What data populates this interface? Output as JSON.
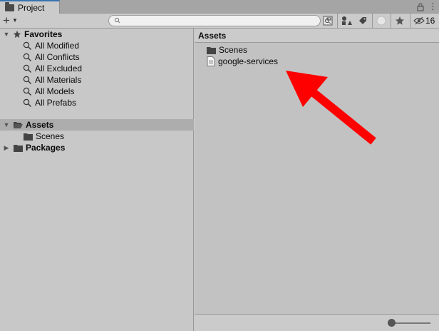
{
  "window": {
    "tab_title": "Project"
  },
  "toolbar": {
    "hidden_count": "16"
  },
  "sidebar": {
    "favorites": {
      "label": "Favorites",
      "items": [
        "All Modified",
        "All Conflicts",
        "All Excluded",
        "All Materials",
        "All Models",
        "All Prefabs"
      ]
    },
    "assets": {
      "label": "Assets",
      "children": [
        "Scenes"
      ]
    },
    "packages": {
      "label": "Packages"
    }
  },
  "main": {
    "breadcrumb": "Assets",
    "items": [
      {
        "name": "Scenes",
        "icon": "folder-icon"
      },
      {
        "name": "google-services",
        "icon": "file-icon"
      }
    ]
  },
  "colors": {
    "annotation_arrow": "#ff0000",
    "tab_accent": "#3a72b0"
  }
}
